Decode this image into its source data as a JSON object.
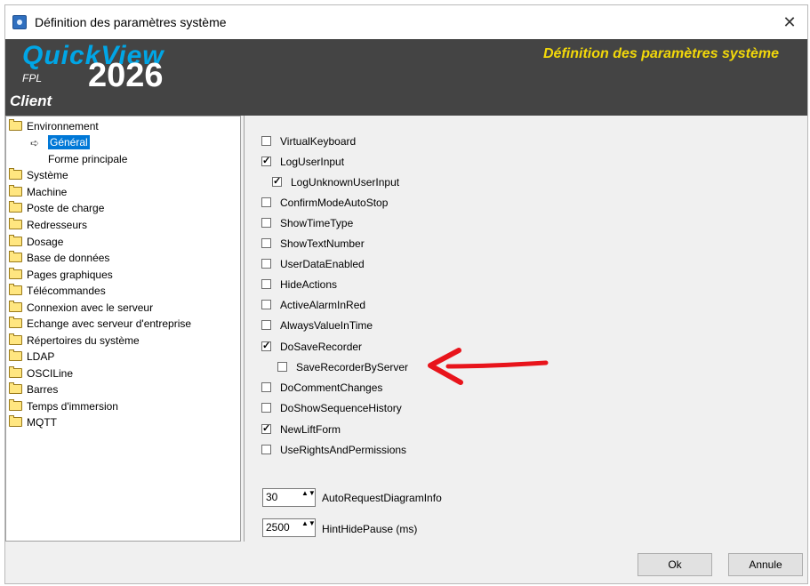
{
  "window": {
    "title": "Définition des paramètres système",
    "close_glyph": "✕"
  },
  "banner": {
    "brand": "QuickView",
    "year": "2026",
    "fpl": "FPL",
    "client": "Client",
    "title": "Définition des paramètres système",
    "title_color": "#f2d80a",
    "brand_color": "#00a6e6"
  },
  "tree": {
    "items": [
      {
        "label": "Environnement",
        "icon": "folder-icon"
      },
      {
        "label": "Général",
        "icon": "arrow-right-icon",
        "selected": true
      },
      {
        "label": "Forme principale"
      },
      {
        "label": "Système",
        "icon": "folder-icon"
      },
      {
        "label": "Machine",
        "icon": "folder-icon"
      },
      {
        "label": "Poste de charge",
        "icon": "folder-icon"
      },
      {
        "label": "Redresseurs",
        "icon": "folder-icon"
      },
      {
        "label": "Dosage",
        "icon": "folder-icon"
      },
      {
        "label": "Base de données",
        "icon": "folder-icon"
      },
      {
        "label": "Pages graphiques",
        "icon": "folder-icon"
      },
      {
        "label": "Télécommandes",
        "icon": "folder-icon"
      },
      {
        "label": "Connexion avec le serveur",
        "icon": "folder-icon"
      },
      {
        "label": "Echange avec serveur d'entreprise",
        "icon": "folder-icon"
      },
      {
        "label": "Répertoires du système",
        "icon": "folder-icon"
      },
      {
        "label": "LDAP",
        "icon": "folder-icon"
      },
      {
        "label": "OSCILine",
        "icon": "folder-icon"
      },
      {
        "label": "Barres",
        "icon": "folder-icon"
      },
      {
        "label": "Temps d'immersion",
        "icon": "folder-icon"
      },
      {
        "label": "MQTT",
        "icon": "folder-icon"
      }
    ]
  },
  "settings": {
    "checkboxes": [
      {
        "label": "VirtualKeyboard",
        "checked": false
      },
      {
        "label": "LogUserInput",
        "checked": true
      },
      {
        "label": "LogUnknownUserInput",
        "checked": true
      },
      {
        "label": "ConfirmModeAutoStop",
        "checked": false
      },
      {
        "label": "ShowTimeType",
        "checked": false
      },
      {
        "label": "ShowTextNumber",
        "checked": false
      },
      {
        "label": "UserDataEnabled",
        "checked": false
      },
      {
        "label": "HideActions",
        "checked": false
      },
      {
        "label": "ActiveAlarmInRed",
        "checked": false
      },
      {
        "label": "AlwaysValueInTime",
        "checked": false
      },
      {
        "label": "DoSaveRecorder",
        "checked": true
      },
      {
        "label": "SaveRecorderByServer",
        "checked": false
      },
      {
        "label": "DoCommentChanges",
        "checked": false
      },
      {
        "label": "DoShowSequenceHistory",
        "checked": false
      },
      {
        "label": "NewLiftForm",
        "checked": true
      },
      {
        "label": "UseRightsAndPermissions",
        "checked": false
      }
    ],
    "spinners": [
      {
        "value": "30",
        "label": "AutoRequestDiagramInfo"
      },
      {
        "value": "2500",
        "label": "HintHidePause (ms)"
      }
    ],
    "spin_glyph": "▲▼",
    "check_glyph": "✓"
  },
  "footer": {
    "ok_label": "Ok",
    "cancel_label": "Annule"
  },
  "annotation_color": "#e8141b"
}
